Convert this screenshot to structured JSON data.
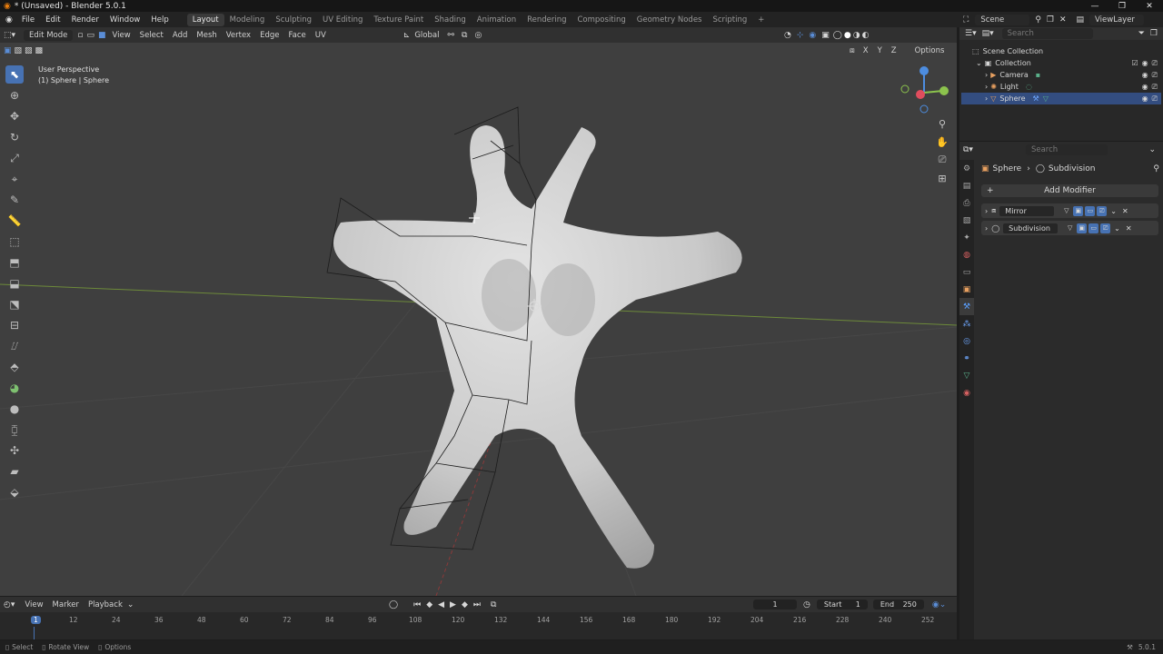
{
  "window": {
    "title": "* (Unsaved) - Blender 5.0.1",
    "min": "—",
    "max": "❐",
    "close": "✕"
  },
  "menubar": {
    "menus": [
      "File",
      "Edit",
      "Render",
      "Window",
      "Help"
    ],
    "workspaces": [
      "Layout",
      "Modeling",
      "Sculpting",
      "UV Editing",
      "Texture Paint",
      "Shading",
      "Animation",
      "Rendering",
      "Compositing",
      "Geometry Nodes",
      "Scripting"
    ],
    "active_workspace": "Layout",
    "scene": "Scene",
    "view_layer": "ViewLayer"
  },
  "viewport_header": {
    "mode": "Edit Mode",
    "menus": [
      "View",
      "Select",
      "Add",
      "Mesh",
      "Vertex",
      "Edge",
      "Face",
      "UV"
    ],
    "transform_orientation": "Global",
    "options_label": "Options",
    "axis_x": "X",
    "axis_y": "Y",
    "axis_z": "Z"
  },
  "viewport": {
    "perspective_label": "User Perspective",
    "object_label": "(1) Sphere | Sphere"
  },
  "outliner": {
    "search_placeholder": "Search",
    "root": "Scene Collection",
    "collection": "Collection",
    "items": [
      {
        "name": "Camera",
        "selected": false
      },
      {
        "name": "Light",
        "selected": false
      },
      {
        "name": "Sphere",
        "selected": true
      }
    ]
  },
  "properties": {
    "search_placeholder": "Search",
    "breadcrumb_object": "Sphere",
    "breadcrumb_modifier": "Subdivision",
    "add_modifier_label": "Add Modifier",
    "modifiers": [
      {
        "name": "Mirror"
      },
      {
        "name": "Subdivision"
      }
    ]
  },
  "timeline": {
    "menus": [
      "View",
      "Marker",
      "Playback"
    ],
    "current_frame": "1",
    "start_label": "Start",
    "start_value": "1",
    "end_label": "End",
    "end_value": "250",
    "ticks": [
      "1",
      "12",
      "24",
      "36",
      "48",
      "60",
      "72",
      "84",
      "96",
      "108",
      "120",
      "132",
      "144",
      "156",
      "168",
      "180",
      "192",
      "204",
      "216",
      "228",
      "240",
      "252"
    ]
  },
  "statusbar": {
    "select": "Select",
    "rotate": "Rotate View",
    "options": "Options",
    "version": "5.0.1"
  },
  "colors": {
    "accent": "#4772b3",
    "selection": "#334d80",
    "viewport_bg": "#3f3f3f"
  }
}
